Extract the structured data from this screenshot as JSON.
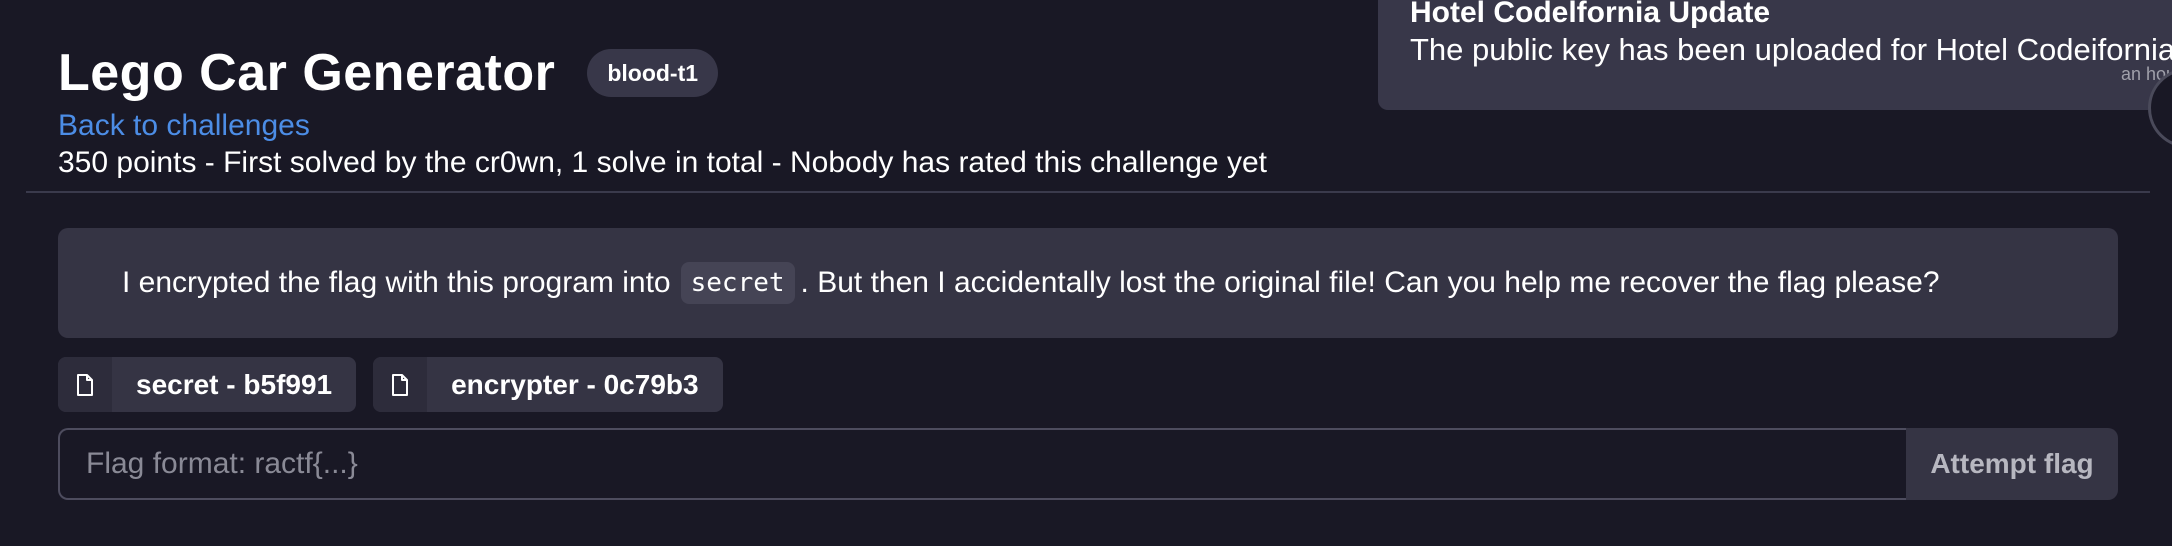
{
  "challenge": {
    "title": "Lego Car Generator",
    "badge": "blood-t1",
    "back_link": "Back to challenges",
    "meta": "350 points - First solved by the cr0wn, 1 solve in total - Nobody has rated this challenge yet"
  },
  "description": {
    "before": "I encrypted the flag with this program into",
    "code": "secret",
    "after": ". But then I accidentally lost the original file! Can you help me recover the flag please?"
  },
  "files": [
    {
      "label": "secret - b5f991",
      "icon": "file-icon"
    },
    {
      "label": "encrypter - 0c79b3",
      "icon": "file-icon"
    }
  ],
  "flag": {
    "placeholder": "Flag format: ractf{...}",
    "value": "",
    "button": "Attempt flag"
  },
  "notification": {
    "title": "Hotel Codelfornia Update",
    "body": "The public key has been uploaded for Hotel Codeifornia",
    "time": "an hou"
  }
}
